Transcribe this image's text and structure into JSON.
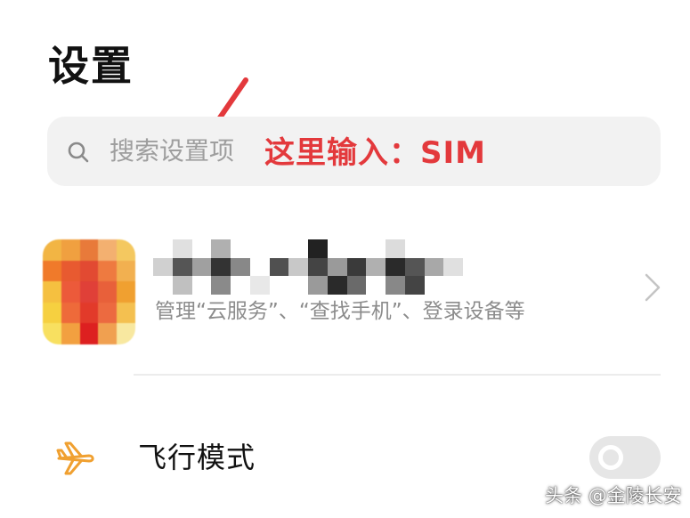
{
  "header": {
    "title": "设置"
  },
  "search": {
    "placeholder": "搜索设置项",
    "icon": "search-icon"
  },
  "annotation": {
    "text": "这里输入：SIM",
    "color": "#e3393c"
  },
  "account": {
    "subtitle": "管理“云服务”、“查找手机”、登录设备等",
    "avatar_pixels": [
      "#f2b544",
      "#f0a040",
      "#e87a3a",
      "#f3b070",
      "#f4c860",
      "#f07a2a",
      "#e85a30",
      "#e24a32",
      "#ee7a40",
      "#f2b050",
      "#f5c040",
      "#ec5a3a",
      "#e04038",
      "#e8603a",
      "#f0a030",
      "#f6d040",
      "#ee6a3a",
      "#e23a2a",
      "#ec6a40",
      "#f4c050",
      "#f8e060",
      "#f2a040",
      "#dd2020",
      "#f0a050",
      "#f8e8a0"
    ],
    "name_pixels": [
      "#ffffff",
      "#e0e0e0",
      "#ffffff",
      "#b0b0b0",
      "#ffffff",
      "#ffffff",
      "#ffffff",
      "#ffffff",
      "#222222",
      "#ffffff",
      "#ffffff",
      "#ffffff",
      "#dcdcdc",
      "#ffffff",
      "#ffffff",
      "#ffffff",
      "#ffffff",
      "#d0d0d0",
      "#555555",
      "#a0a0a0",
      "#333333",
      "#888888",
      "#ffffff",
      "#505050",
      "#c8c8c8",
      "#444444",
      "#9a9a9a",
      "#3a3a3a",
      "#b0b0b0",
      "#2a2a2a",
      "#555555",
      "#a8a8a8",
      "#e0e0e0",
      "#ffffff",
      "#ffffff",
      "#c0c0c0",
      "#ffffff",
      "#8a8a8a",
      "#ffffff",
      "#e8e8e8",
      "#ffffff",
      "#ffffff",
      "#9a9a9a",
      "#2a2a2a",
      "#6a6a6a",
      "#ffffff",
      "#888888",
      "#444444",
      "#ffffff",
      "#ffffff",
      "#ffffff"
    ]
  },
  "airplane": {
    "label": "飞行模式",
    "icon": "airplane-icon",
    "icon_color": "#f0a030",
    "toggle_on": false
  },
  "watermark": {
    "text": "头条 @金陵长安"
  }
}
